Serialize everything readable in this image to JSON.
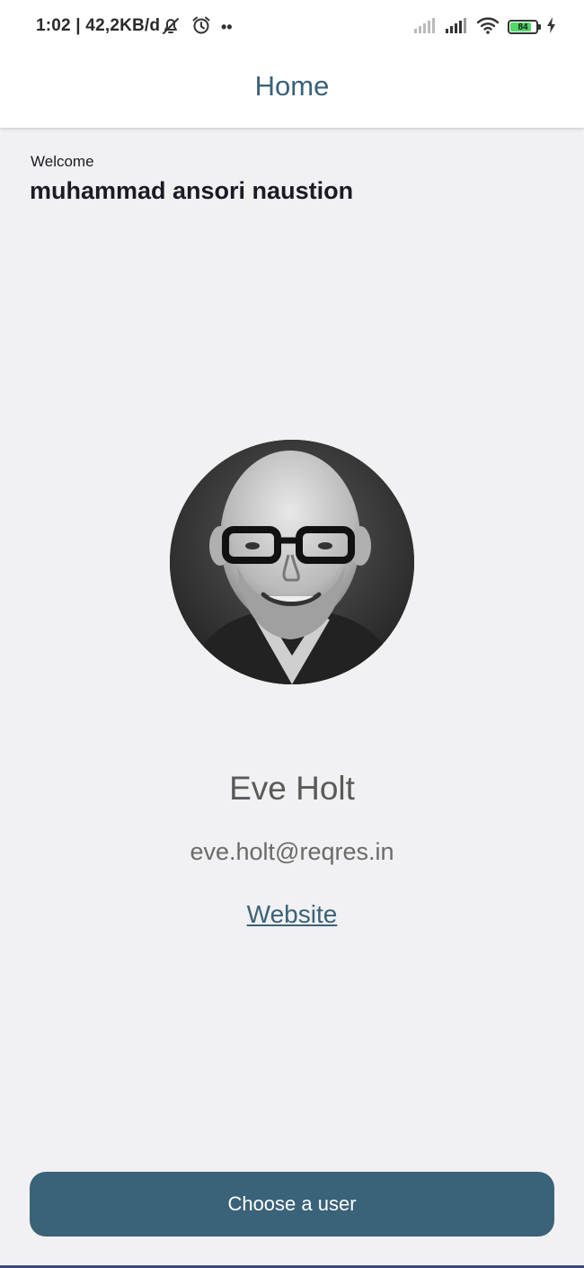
{
  "status_bar": {
    "time": "1:02 | 42,2KB/d",
    "dots": "••",
    "battery_level": "84",
    "battery_fraction": 0.84,
    "icons": [
      "mute-icon",
      "alarm-icon",
      "signal-icon",
      "signal-icon",
      "wifi-icon",
      "battery-icon",
      "charging-icon"
    ]
  },
  "app_bar": {
    "title": "Home"
  },
  "greeting": {
    "welcome_label": "Welcome",
    "user_name": "muhammad ansori naustion"
  },
  "profile": {
    "name": "Eve Holt",
    "email": "eve.holt@reqres.in",
    "website_label": "Website"
  },
  "actions": {
    "choose_user_label": "Choose a user"
  },
  "colors": {
    "primary": "#3a6279",
    "background": "#f1f0f2",
    "text_dark": "#1b1b24",
    "text_gray": "#5a5a5a"
  }
}
